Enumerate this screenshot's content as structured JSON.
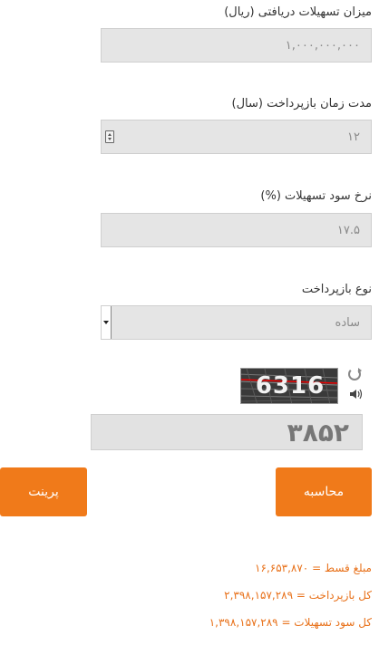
{
  "fields": {
    "amount_label": "میزان تسهیلات دریافتی (ریال)",
    "amount_value": "۱,۰۰۰,۰۰۰,۰۰۰",
    "duration_label": "مدت زمان بازپرداخت (سال)",
    "duration_value": "۱۲",
    "rate_label": "نرخ سود تسهیلات (%)",
    "rate_value": "۱۷.۵",
    "type_label": "نوع بازپرداخت",
    "type_value": "ساده"
  },
  "captcha": {
    "image_text": "6316",
    "input_value": "۳۸۵۲"
  },
  "buttons": {
    "calculate": "محاسبه",
    "print": "پرینت"
  },
  "results": {
    "installment": "مبلغ قسط = ۱۶,۶۵۳,۸۷۰",
    "total_payment": "کل بازپرداخت = ۲,۳۹۸,۱۵۷,۲۸۹",
    "total_interest": "کل سود تسهیلات = ۱,۳۹۸,۱۵۷,۲۸۹"
  },
  "colors": {
    "accent": "#f07a1a",
    "result_text": "#e8711a",
    "field_bg": "#e5e5e5"
  }
}
